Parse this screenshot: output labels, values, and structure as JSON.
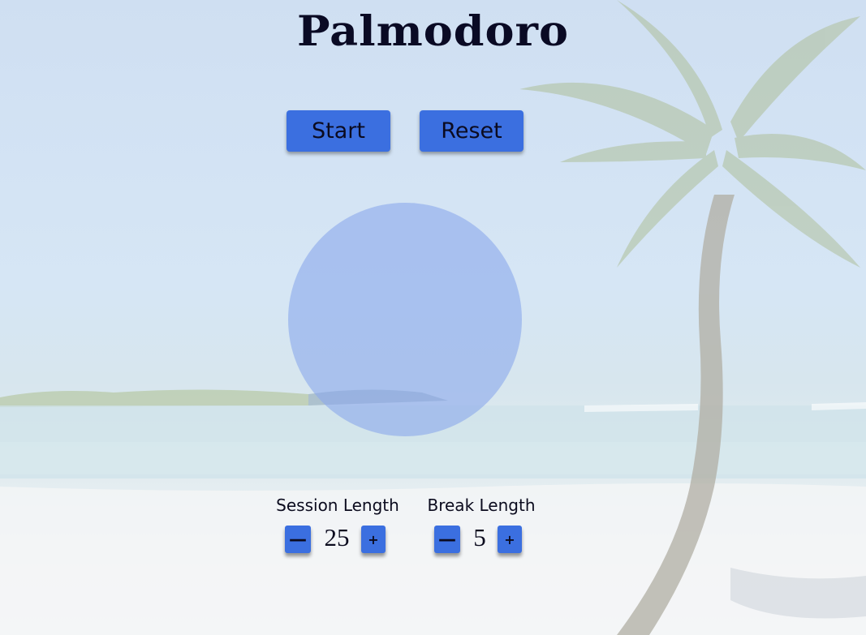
{
  "app": {
    "title": "Palmodoro"
  },
  "controls": {
    "start_label": "Start",
    "reset_label": "Reset"
  },
  "session": {
    "label": "Session Length",
    "value": "25",
    "decrement_icon": "minus-icon",
    "increment_icon": "plus-icon"
  },
  "break": {
    "label": "Break Length",
    "value": "5",
    "decrement_icon": "minus-icon",
    "increment_icon": "plus-icon"
  },
  "colors": {
    "button": "#3b6fe0",
    "timer_circle": "#8caaeb",
    "text": "#0b0b1e"
  }
}
